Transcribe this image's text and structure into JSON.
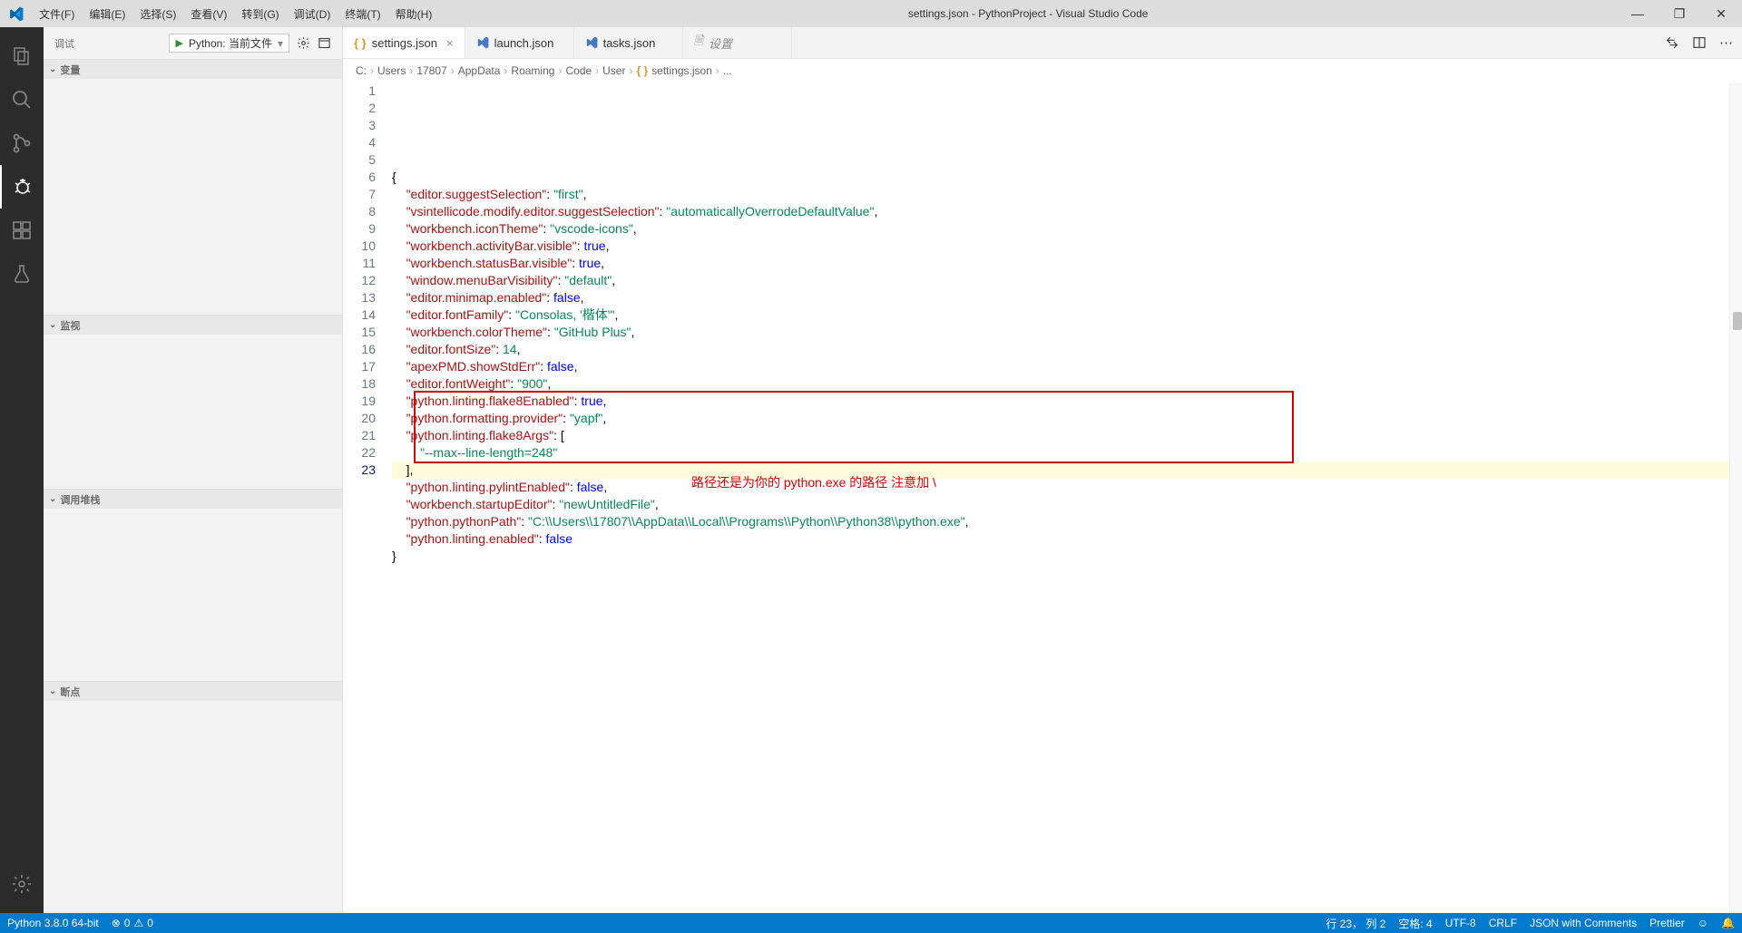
{
  "title": "settings.json - PythonProject - Visual Studio Code",
  "menu": [
    "文件(F)",
    "编辑(E)",
    "选择(S)",
    "查看(V)",
    "转到(G)",
    "调试(D)",
    "终端(T)",
    "帮助(H)"
  ],
  "sidebar": {
    "header_title": "调试",
    "run_label": "Python: 当前文件",
    "sections": [
      "变量",
      "监视",
      "调用堆栈",
      "断点"
    ]
  },
  "tabs": [
    {
      "label": "settings.json",
      "icon": "braces",
      "active": true,
      "close": true
    },
    {
      "label": "launch.json",
      "icon": "vsicon",
      "active": false,
      "close": false
    },
    {
      "label": "tasks.json",
      "icon": "vsicon",
      "active": false,
      "close": false
    },
    {
      "label": "设置",
      "icon": "doc",
      "active": false,
      "close": false,
      "italic": true
    }
  ],
  "breadcrumb": [
    "C:",
    "Users",
    "17807",
    "AppData",
    "Roaming",
    "Code",
    "User",
    "settings.json",
    "..."
  ],
  "code": {
    "lines": [
      {
        "n": 1,
        "t": [
          {
            "c": "tok-punc",
            "v": "{"
          }
        ]
      },
      {
        "n": 2,
        "t": [
          {
            "c": "",
            "v": "    "
          },
          {
            "c": "tok-key",
            "v": "\"editor.suggestSelection\""
          },
          {
            "c": "tok-punc",
            "v": ": "
          },
          {
            "c": "tok-str",
            "v": "\"first\""
          },
          {
            "c": "tok-punc",
            "v": ","
          }
        ]
      },
      {
        "n": 3,
        "t": [
          {
            "c": "",
            "v": "    "
          },
          {
            "c": "tok-key",
            "v": "\"vsintellicode.modify.editor.suggestSelection\""
          },
          {
            "c": "tok-punc",
            "v": ": "
          },
          {
            "c": "tok-str",
            "v": "\"automaticallyOverrodeDefaultValue\""
          },
          {
            "c": "tok-punc",
            "v": ","
          }
        ]
      },
      {
        "n": 4,
        "t": [
          {
            "c": "",
            "v": "    "
          },
          {
            "c": "tok-key",
            "v": "\"workbench.iconTheme\""
          },
          {
            "c": "tok-punc",
            "v": ": "
          },
          {
            "c": "tok-str",
            "v": "\"vscode-icons\""
          },
          {
            "c": "tok-punc",
            "v": ","
          }
        ]
      },
      {
        "n": 5,
        "t": [
          {
            "c": "",
            "v": "    "
          },
          {
            "c": "tok-key",
            "v": "\"workbench.activityBar.visible\""
          },
          {
            "c": "tok-punc",
            "v": ": "
          },
          {
            "c": "tok-bool",
            "v": "true"
          },
          {
            "c": "tok-punc",
            "v": ","
          }
        ]
      },
      {
        "n": 6,
        "t": [
          {
            "c": "",
            "v": "    "
          },
          {
            "c": "tok-key",
            "v": "\"workbench.statusBar.visible\""
          },
          {
            "c": "tok-punc",
            "v": ": "
          },
          {
            "c": "tok-bool",
            "v": "true"
          },
          {
            "c": "tok-punc",
            "v": ","
          }
        ]
      },
      {
        "n": 7,
        "t": [
          {
            "c": "",
            "v": "    "
          },
          {
            "c": "tok-key",
            "v": "\"window.menuBarVisibility\""
          },
          {
            "c": "tok-punc",
            "v": ": "
          },
          {
            "c": "tok-str",
            "v": "\"default\""
          },
          {
            "c": "tok-punc",
            "v": ","
          }
        ]
      },
      {
        "n": 8,
        "t": [
          {
            "c": "",
            "v": "    "
          },
          {
            "c": "tok-key",
            "v": "\"editor.minimap.enabled\""
          },
          {
            "c": "tok-punc",
            "v": ": "
          },
          {
            "c": "tok-bool",
            "v": "false"
          },
          {
            "c": "tok-punc",
            "v": ","
          }
        ]
      },
      {
        "n": 9,
        "t": [
          {
            "c": "",
            "v": "    "
          },
          {
            "c": "tok-key",
            "v": "\"editor.fontFamily\""
          },
          {
            "c": "tok-punc",
            "v": ": "
          },
          {
            "c": "tok-str",
            "v": "\"Consolas, '楷体'\""
          },
          {
            "c": "tok-punc",
            "v": ","
          }
        ]
      },
      {
        "n": 10,
        "t": [
          {
            "c": "",
            "v": "    "
          },
          {
            "c": "tok-key",
            "v": "\"workbench.colorTheme\""
          },
          {
            "c": "tok-punc",
            "v": ": "
          },
          {
            "c": "tok-str",
            "v": "\"GitHub Plus\""
          },
          {
            "c": "tok-punc",
            "v": ","
          }
        ]
      },
      {
        "n": 11,
        "t": [
          {
            "c": "",
            "v": "    "
          },
          {
            "c": "tok-key",
            "v": "\"editor.fontSize\""
          },
          {
            "c": "tok-punc",
            "v": ": "
          },
          {
            "c": "tok-num",
            "v": "14"
          },
          {
            "c": "tok-punc",
            "v": ","
          }
        ]
      },
      {
        "n": 12,
        "t": [
          {
            "c": "",
            "v": "    "
          },
          {
            "c": "tok-key",
            "v": "\"apexPMD.showStdErr\""
          },
          {
            "c": "tok-punc",
            "v": ": "
          },
          {
            "c": "tok-bool",
            "v": "false"
          },
          {
            "c": "tok-punc",
            "v": ","
          }
        ]
      },
      {
        "n": 13,
        "t": [
          {
            "c": "",
            "v": "    "
          },
          {
            "c": "tok-key",
            "v": "\"editor.fontWeight\""
          },
          {
            "c": "tok-punc",
            "v": ": "
          },
          {
            "c": "tok-str",
            "v": "\"900\""
          },
          {
            "c": "tok-punc",
            "v": ","
          }
        ]
      },
      {
        "n": 14,
        "t": [
          {
            "c": "",
            "v": "    "
          },
          {
            "c": "tok-key",
            "v": "\"python.linting.flake8Enabled\""
          },
          {
            "c": "tok-punc",
            "v": ": "
          },
          {
            "c": "tok-bool",
            "v": "true"
          },
          {
            "c": "tok-punc",
            "v": ","
          }
        ]
      },
      {
        "n": 15,
        "t": [
          {
            "c": "",
            "v": "    "
          },
          {
            "c": "tok-key",
            "v": "\"python.formatting.provider\""
          },
          {
            "c": "tok-punc",
            "v": ": "
          },
          {
            "c": "tok-str",
            "v": "\"yapf\""
          },
          {
            "c": "tok-punc",
            "v": ","
          }
        ]
      },
      {
        "n": 16,
        "t": [
          {
            "c": "",
            "v": "    "
          },
          {
            "c": "tok-key",
            "v": "\"python.linting.flake8Args\""
          },
          {
            "c": "tok-punc",
            "v": ": ["
          }
        ]
      },
      {
        "n": 17,
        "t": [
          {
            "c": "",
            "v": "        "
          },
          {
            "c": "tok-str",
            "v": "\"--max--line-length=248\""
          }
        ]
      },
      {
        "n": 18,
        "t": [
          {
            "c": "",
            "v": "    "
          },
          {
            "c": "tok-punc",
            "v": "],"
          }
        ]
      },
      {
        "n": 19,
        "t": [
          {
            "c": "",
            "v": "    "
          },
          {
            "c": "tok-key",
            "v": "\"python.linting.pylintEnabled\""
          },
          {
            "c": "tok-punc",
            "v": ": "
          },
          {
            "c": "tok-bool",
            "v": "false"
          },
          {
            "c": "tok-punc",
            "v": ","
          }
        ]
      },
      {
        "n": 20,
        "t": [
          {
            "c": "",
            "v": "    "
          },
          {
            "c": "tok-key",
            "v": "\"workbench.startupEditor\""
          },
          {
            "c": "tok-punc",
            "v": ": "
          },
          {
            "c": "tok-str",
            "v": "\"newUntitledFile\""
          },
          {
            "c": "tok-punc",
            "v": ","
          }
        ]
      },
      {
        "n": 21,
        "t": [
          {
            "c": "",
            "v": "    "
          },
          {
            "c": "tok-key",
            "v": "\"python.pythonPath\""
          },
          {
            "c": "tok-punc",
            "v": ": "
          },
          {
            "c": "tok-str",
            "v": "\"C:\\\\Users\\\\17807\\\\AppData\\\\Local\\\\Programs\\\\Python\\\\Python38\\\\python.exe\""
          },
          {
            "c": "tok-punc",
            "v": ","
          }
        ]
      },
      {
        "n": 22,
        "t": [
          {
            "c": "",
            "v": "    "
          },
          {
            "c": "tok-key",
            "v": "\"python.linting.enabled\""
          },
          {
            "c": "tok-punc",
            "v": ": "
          },
          {
            "c": "tok-bool",
            "v": "false"
          }
        ]
      },
      {
        "n": 23,
        "t": [
          {
            "c": "tok-punc",
            "v": "}"
          }
        ],
        "current": true
      }
    ],
    "annotation": "路径还是为你的 python.exe 的路径 注意加 \\"
  },
  "statusbar": {
    "python": "Python 3.8.0 64-bit",
    "errors": "0",
    "warnings": "0",
    "line_col": "行 23， 列 2",
    "spaces": "空格: 4",
    "encoding": "UTF-8",
    "eol": "CRLF",
    "lang": "JSON with Comments",
    "formatter": "Prettier"
  }
}
